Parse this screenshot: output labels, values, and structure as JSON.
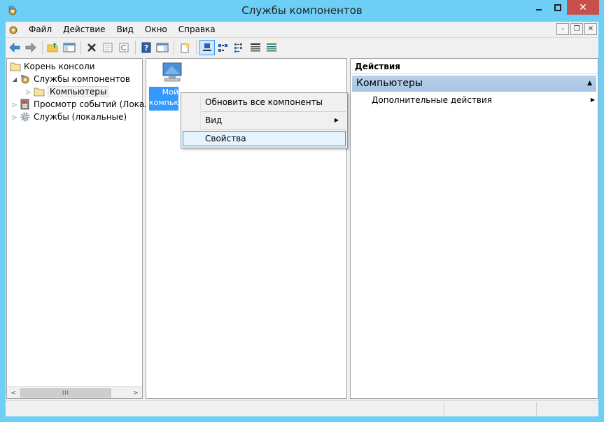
{
  "window": {
    "title": "Службы компонентов",
    "close_glyph": "✕"
  },
  "menu": {
    "items": [
      "Файл",
      "Действие",
      "Вид",
      "Окно",
      "Справка"
    ]
  },
  "mdi": {
    "minimize": "–",
    "restore": "❐",
    "close": "✕"
  },
  "toolbar": {
    "buttons": [
      "back-arrow-icon",
      "forward-arrow-icon",
      "up-folder-icon",
      "show-tree-icon",
      "delete-icon",
      "properties-icon",
      "refresh-icon",
      "help-icon",
      "action-pane-icon",
      "new-icon",
      "large-icons-view-icon",
      "small-icons-view-icon",
      "list-view-icon",
      "details-view-icon",
      "com-view-icon"
    ],
    "active": "large-icons-view-icon"
  },
  "tree": {
    "items": [
      {
        "label": "Корень консоли",
        "arrow": ""
      },
      {
        "label": "Службы компонентов",
        "arrow": "◢"
      },
      {
        "label": "Компьютеры",
        "arrow": "▷"
      },
      {
        "label": "Просмотр событий (Локал",
        "arrow": "▷"
      },
      {
        "label": "Службы (локальные)",
        "arrow": "▷"
      }
    ],
    "scroll": {
      "left": "<",
      "right": ">",
      "thumb": "III"
    }
  },
  "list": {
    "item_label": "Мой компьютер"
  },
  "context_menu": {
    "items": [
      {
        "label": "Обновить все компоненты"
      },
      {
        "label": "Вид",
        "arrow": "▶"
      },
      {
        "label": "Свойства"
      }
    ]
  },
  "actions": {
    "header": "Действия",
    "section": "Компьютеры",
    "section_arrow": "▲",
    "item": "Дополнительные действия",
    "item_arrow": "▶"
  },
  "colors": {
    "title_bar": "#6dcff6",
    "close": "#c7504a",
    "selection": "#3399ff",
    "section": "#b8d1ea"
  }
}
